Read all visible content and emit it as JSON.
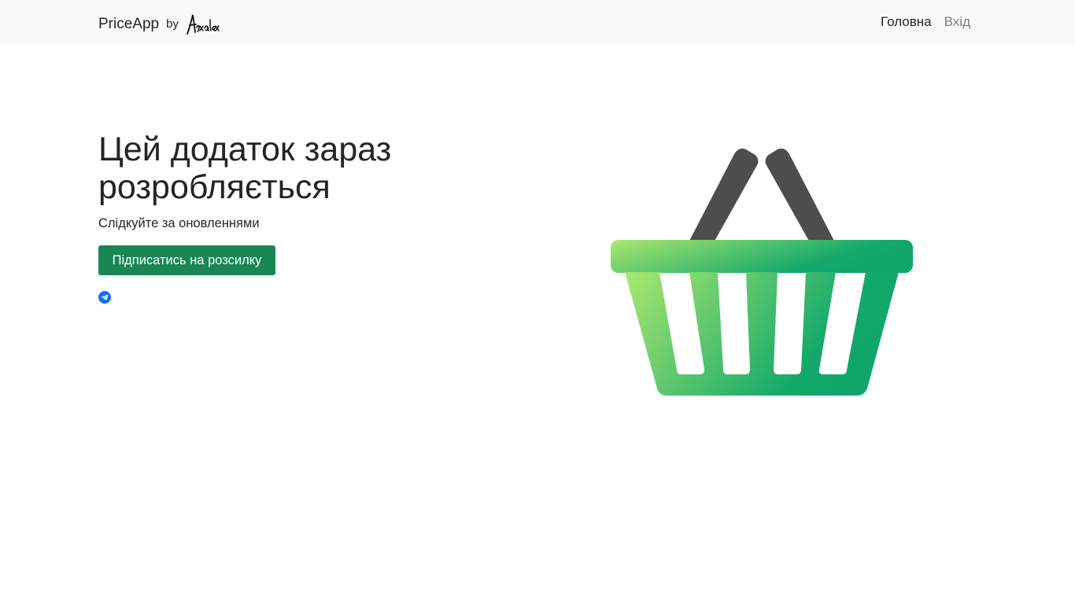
{
  "navbar": {
    "brand_name": "PriceApp",
    "brand_by": "by",
    "brand_logo_icon": "arxalex-signature-logo",
    "links": [
      {
        "label": "Головна",
        "active": true
      },
      {
        "label": "Вхід",
        "active": false
      }
    ]
  },
  "hero": {
    "title": "Цей додаток зараз розробляється",
    "subtitle": "Слідкуйте за оновленнями",
    "subscribe_label": "Підписатись на розсилку",
    "telegram_icon": "telegram-icon",
    "illustration_icon": "shopping-basket-icon"
  },
  "colors": {
    "navbar_bg": "#f8f9fa",
    "button_bg": "#198754",
    "telegram_blue": "#0d6efd",
    "basket_gradient_start": "#a9e86f",
    "basket_gradient_end": "#12a76c",
    "basket_handle": "#4d4d4d"
  }
}
